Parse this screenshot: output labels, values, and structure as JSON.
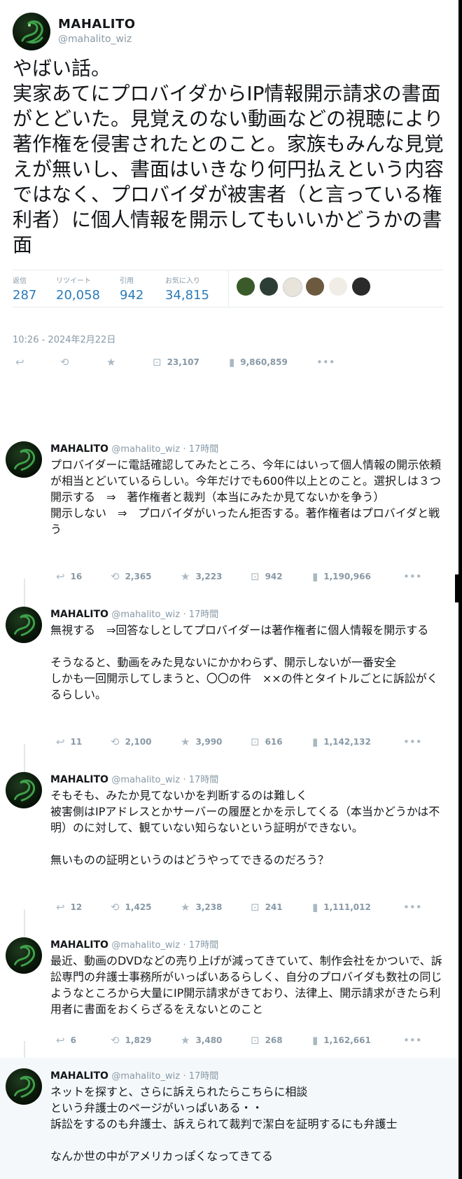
{
  "main_tweet": {
    "name": "MAHALITO",
    "handle": "@mahalito_wiz",
    "text": "やばい話。\n実家あてにプロバイダからIP情報開示請求の書面がとどいた。見覚えのない動画などの視聴により著作権を侵害されたとのこと。家族もみんな見覚えが無いし、書面はいきなり何円払えという内容ではなく、プロバイダが被害者（と言っている権利者）に個人情報を開示してもいいかどうかの書面",
    "stats": {
      "replies_label": "返信",
      "replies": "287",
      "retweets_label": "リツイート",
      "retweets": "20,058",
      "quotes_label": "引用",
      "quotes": "942",
      "likes_label": "お気に入り",
      "likes": "34,815"
    },
    "timestamp": "10:26 - 2024年2月22日",
    "actions": {
      "views": "23,107",
      "impressions": "9,860,859"
    }
  },
  "icons": {
    "reply": "reply-icon",
    "retweet": "retweet-icon",
    "like": "star-icon",
    "book": "book-icon",
    "analytics": "bar-chart-icon",
    "more": "more-icon"
  },
  "colors": {
    "accent": "#2b7bb9",
    "muted": "#8899a6",
    "icon": "#aab8c2",
    "highlight_bg": "#f5f8fa"
  },
  "replies": [
    {
      "name": "MAHALITO",
      "handle": "@mahalito_wiz",
      "time": "· 17時間",
      "text": "プロバイダーに電話確認してみたところ、今年にはいって個人情報の開示依頼が相当とどいているらしい。今年だけでも600件以上とのこと。選択しは３つ\n開示する　⇒　著作権者と裁判（本当にみたか見てないかを争う）\n開示しない　⇒　プロバイダがいったん拒否する。著作権者はプロバイダと戦う",
      "counts": {
        "reply": "16",
        "retweet": "2,365",
        "like": "3,223",
        "book": "942",
        "views": "1,190,966"
      }
    },
    {
      "name": "MAHALITO",
      "handle": "@mahalito_wiz",
      "time": "· 17時間",
      "text": "無視する　⇒回答なしとしてプロバイダーは著作権者に個人情報を開示する\n\nそうなると、動画をみた見ないにかかわらず、開示しないが一番安全\nしかも一回開示してしまうと、〇〇の件　××の件とタイトルごとに訴訟がくるらしい。",
      "counts": {
        "reply": "11",
        "retweet": "2,100",
        "like": "3,990",
        "book": "616",
        "views": "1,142,132"
      }
    },
    {
      "name": "MAHALITO",
      "handle": "@mahalito_wiz",
      "time": "· 17時間",
      "text": "そもそも、みたか見てないかを判断するのは難しく\n被害側はIPアドレスとかサーバーの履歴とかを示してくる（本当かどうかは不明）のに対して、観ていない知らないという証明ができない。\n\n無いものの証明というのはどうやってできるのだろう？",
      "counts": {
        "reply": "12",
        "retweet": "1,425",
        "like": "3,238",
        "book": "241",
        "views": "1,111,012"
      }
    },
    {
      "name": "MAHALITO",
      "handle": "@mahalito_wiz",
      "time": "· 17時間",
      "text": "最近、動画のDVDなどの売り上げが減ってきていて、制作会社をかついで、訴訟専門の弁護士事務所がいっぱいあるらしく、自分のプロバイダも数社の同じようなところから大量にIP開示請求がきており、法律上、開示請求がきたら利用者に書面をおくらざるをえないとのこと",
      "counts": {
        "reply": "6",
        "retweet": "1,829",
        "like": "3,480",
        "book": "268",
        "views": "1,162,661"
      }
    },
    {
      "name": "MAHALITO",
      "handle": "@mahalito_wiz",
      "time": "· 17時間",
      "text": "ネットを探すと、さらに訴えられたらこちらに相談\nという弁護士のページがいっぱいある・・\n訴訟をするのも弁護士、訴えられて裁判で潔白を証明するにも弁護士\n\nなんか世の中がアメリカっぽくなってきてる"
    }
  ]
}
